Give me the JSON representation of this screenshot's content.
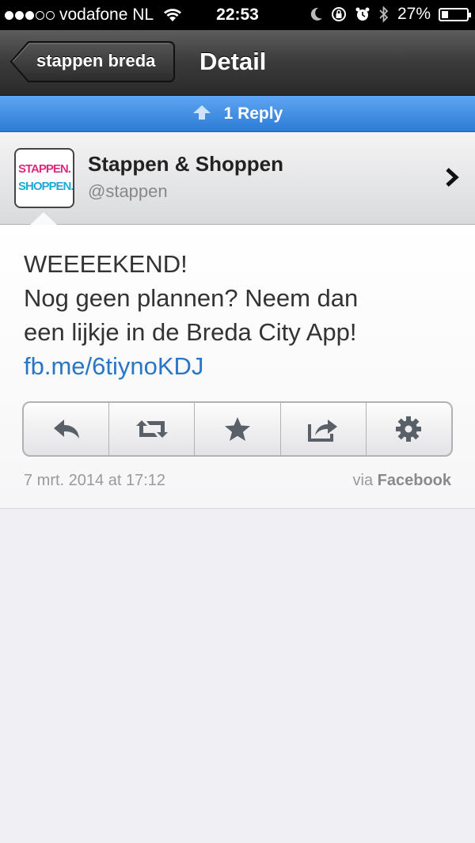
{
  "statusbar": {
    "carrier": "vodafone NL",
    "time": "22:53",
    "battery": "27%"
  },
  "navbar": {
    "back_label": "stappen breda",
    "title": "Detail"
  },
  "reply_bar": {
    "label": "1 Reply"
  },
  "user": {
    "name": "Stappen & Shoppen",
    "handle": "@stappen",
    "avatar_line1": "STAPPEN.",
    "avatar_line2": "SHOPPEN."
  },
  "tweet": {
    "line1": "WEEEEKEND!",
    "line2": "Nog geen plannen? Neem dan",
    "line3": "een lijkje in de Breda City App!",
    "link": "fb.me/6tiynoKDJ"
  },
  "actions": [
    "reply-icon",
    "retweet-icon",
    "star-icon",
    "share-icon",
    "gear-icon"
  ],
  "meta": {
    "date": "7 mrt. 2014 at 17:12",
    "via_prefix": "via",
    "via_source": "Facebook"
  },
  "colors": {
    "accent": "#2d7bd8",
    "link": "#2a76c6"
  }
}
